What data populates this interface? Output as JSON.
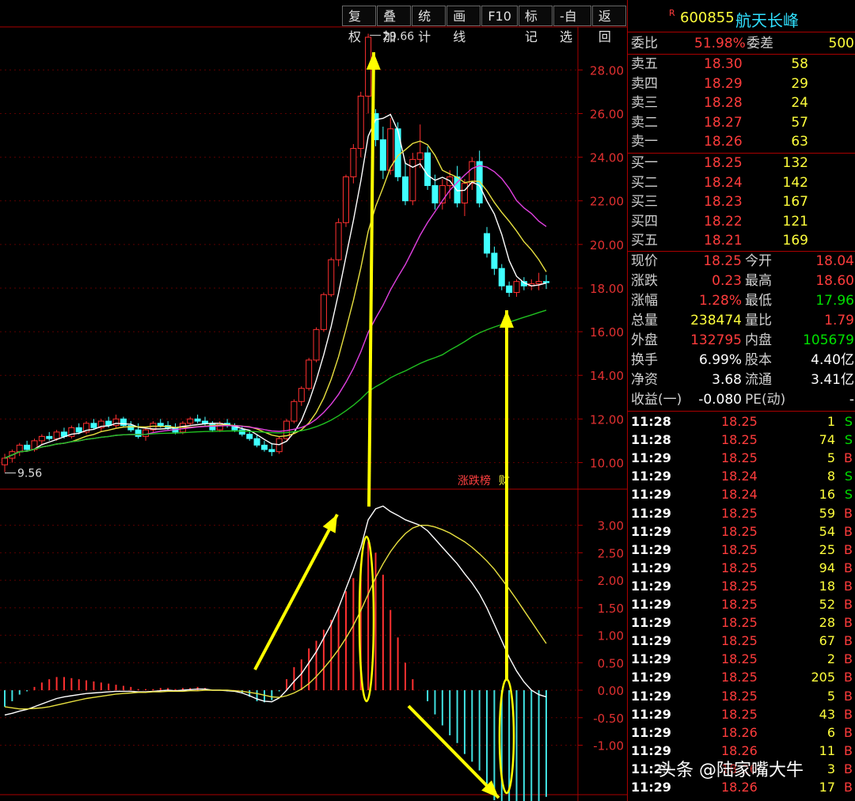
{
  "toolbar": [
    "复权",
    "叠加",
    "统计",
    "画线",
    "F10",
    "标记",
    "-自选",
    "返回"
  ],
  "stock": {
    "r_mark": "R",
    "code": "600855",
    "name": "航天长峰"
  },
  "commission": {
    "label1": "委比",
    "ratio": "51.98%",
    "label2": "委差",
    "diff": "500"
  },
  "asks": [
    {
      "label": "卖五",
      "price": "18.30",
      "vol": "58"
    },
    {
      "label": "卖四",
      "price": "18.29",
      "vol": "29"
    },
    {
      "label": "卖三",
      "price": "18.28",
      "vol": "24"
    },
    {
      "label": "卖二",
      "price": "18.27",
      "vol": "57"
    },
    {
      "label": "卖一",
      "price": "18.26",
      "vol": "63"
    }
  ],
  "bids": [
    {
      "label": "买一",
      "price": "18.25",
      "vol": "132"
    },
    {
      "label": "买二",
      "price": "18.24",
      "vol": "142"
    },
    {
      "label": "买三",
      "price": "18.23",
      "vol": "167"
    },
    {
      "label": "买四",
      "price": "18.22",
      "vol": "121"
    },
    {
      "label": "买五",
      "price": "18.21",
      "vol": "169"
    }
  ],
  "stats": [
    {
      "l1": "现价",
      "v1": "18.25",
      "c1": "red",
      "l2": "今开",
      "v2": "18.04",
      "c2": "red"
    },
    {
      "l1": "涨跌",
      "v1": "0.23",
      "c1": "red",
      "l2": "最高",
      "v2": "18.60",
      "c2": "red"
    },
    {
      "l1": "涨幅",
      "v1": "1.28%",
      "c1": "red",
      "l2": "最低",
      "v2": "17.96",
      "c2": "grn"
    },
    {
      "l1": "总量",
      "v1": "238474",
      "c1": "yel",
      "l2": "量比",
      "v2": "1.79",
      "c2": "red"
    },
    {
      "l1": "外盘",
      "v1": "132795",
      "c1": "red",
      "l2": "内盘",
      "v2": "105679",
      "c2": "grn"
    },
    {
      "l1": "换手",
      "v1": "6.99%",
      "c1": "wht",
      "l2": "股本",
      "v2": "4.40亿",
      "c2": "wht"
    },
    {
      "l1": "净资",
      "v1": "3.68",
      "c1": "wht",
      "l2": "流通",
      "v2": "3.41亿",
      "c2": "wht"
    },
    {
      "l1": "收益(一)",
      "v1": "-0.080",
      "c1": "wht",
      "l2": "PE(动)",
      "v2": "-",
      "c2": "wht"
    }
  ],
  "ticks": [
    {
      "t": "11:28",
      "p": "18.25",
      "v": "1",
      "s": "S"
    },
    {
      "t": "11:28",
      "p": "18.25",
      "v": "74",
      "s": "S"
    },
    {
      "t": "11:29",
      "p": "18.25",
      "v": "5",
      "s": "B"
    },
    {
      "t": "11:29",
      "p": "18.24",
      "v": "8",
      "s": "S"
    },
    {
      "t": "11:29",
      "p": "18.24",
      "v": "16",
      "s": "S"
    },
    {
      "t": "11:29",
      "p": "18.25",
      "v": "59",
      "s": "B"
    },
    {
      "t": "11:29",
      "p": "18.25",
      "v": "54",
      "s": "B"
    },
    {
      "t": "11:29",
      "p": "18.25",
      "v": "25",
      "s": "B"
    },
    {
      "t": "11:29",
      "p": "18.25",
      "v": "94",
      "s": "B"
    },
    {
      "t": "11:29",
      "p": "18.25",
      "v": "18",
      "s": "B"
    },
    {
      "t": "11:29",
      "p": "18.25",
      "v": "52",
      "s": "B"
    },
    {
      "t": "11:29",
      "p": "18.25",
      "v": "28",
      "s": "B"
    },
    {
      "t": "11:29",
      "p": "18.25",
      "v": "67",
      "s": "B"
    },
    {
      "t": "11:29",
      "p": "18.25",
      "v": "2",
      "s": "B"
    },
    {
      "t": "11:29",
      "p": "18.25",
      "v": "205",
      "s": "B"
    },
    {
      "t": "11:29",
      "p": "18.25",
      "v": "5",
      "s": "B"
    },
    {
      "t": "11:29",
      "p": "18.25",
      "v": "43",
      "s": "B"
    },
    {
      "t": "11:29",
      "p": "18.26",
      "v": "6",
      "s": "B"
    },
    {
      "t": "11:29",
      "p": "18.26",
      "v": "11",
      "s": "B"
    },
    {
      "t": "11:29",
      "p": "18.26",
      "v": "3",
      "s": "B"
    },
    {
      "t": "11:29",
      "p": "18.26",
      "v": "17",
      "s": "B"
    }
  ],
  "chart_labels": {
    "high": "29.66",
    "low": "9.56",
    "zhangdie": "涨跌榜",
    "cai": "财"
  },
  "watermark": "头条 @陆家嘴大牛",
  "chart_data": {
    "type": "candlestick",
    "price_axis": {
      "ticks": [
        28,
        26,
        24,
        22,
        20,
        18,
        16,
        14,
        12,
        10
      ],
      "labels": [
        "28.00",
        "26.00",
        "24.00",
        "22.00",
        "20.00",
        "18.00",
        "16.00",
        "14.00",
        "12.00",
        "10.00"
      ],
      "ylim": [
        9.0,
        29.9
      ]
    },
    "macd_axis": {
      "ticks": [
        3,
        2.5,
        2,
        1.5,
        1,
        0.5,
        0,
        -0.5,
        -1
      ],
      "labels": [
        "3.00",
        "2.50",
        "2.00",
        "1.50",
        "1.00",
        "0.50",
        "0.00",
        "-0.50",
        "-1.00"
      ],
      "ylim": [
        -1.9,
        3.6
      ]
    },
    "candles": [
      [
        9.9,
        10.4,
        9.56,
        10.2
      ],
      [
        10.2,
        10.6,
        10.0,
        10.5
      ],
      [
        10.5,
        10.9,
        10.3,
        10.8
      ],
      [
        10.8,
        11.0,
        10.5,
        10.6
      ],
      [
        10.6,
        11.1,
        10.5,
        11.0
      ],
      [
        11.0,
        11.3,
        10.8,
        11.2
      ],
      [
        11.2,
        11.4,
        11.0,
        11.1
      ],
      [
        11.1,
        11.5,
        11.0,
        11.4
      ],
      [
        11.4,
        11.6,
        11.1,
        11.2
      ],
      [
        11.2,
        11.7,
        11.1,
        11.6
      ],
      [
        11.6,
        11.8,
        11.3,
        11.4
      ],
      [
        11.4,
        11.9,
        11.3,
        11.8
      ],
      [
        11.8,
        12.0,
        11.5,
        11.6
      ],
      [
        11.6,
        12.0,
        11.4,
        11.9
      ],
      [
        11.9,
        12.1,
        11.6,
        11.7
      ],
      [
        11.7,
        12.2,
        11.6,
        12.0
      ],
      [
        12.0,
        12.1,
        11.6,
        11.7
      ],
      [
        11.7,
        11.9,
        11.4,
        11.5
      ],
      [
        11.5,
        11.8,
        11.1,
        11.2
      ],
      [
        11.2,
        11.6,
        11.0,
        11.5
      ],
      [
        11.5,
        11.9,
        11.4,
        11.8
      ],
      [
        11.8,
        12.0,
        11.6,
        11.7
      ],
      [
        11.7,
        11.9,
        11.5,
        11.6
      ],
      [
        11.6,
        11.8,
        11.3,
        11.4
      ],
      [
        11.4,
        11.9,
        11.3,
        11.8
      ],
      [
        11.8,
        12.1,
        11.7,
        12.0
      ],
      [
        12.0,
        12.2,
        11.8,
        11.9
      ],
      [
        11.9,
        12.1,
        11.7,
        11.8
      ],
      [
        11.8,
        11.9,
        11.4,
        11.5
      ],
      [
        11.5,
        11.9,
        11.4,
        11.8
      ],
      [
        11.8,
        12.0,
        11.6,
        11.7
      ],
      [
        11.7,
        11.8,
        11.4,
        11.5
      ],
      [
        11.5,
        11.7,
        11.2,
        11.3
      ],
      [
        11.3,
        11.5,
        11.0,
        11.1
      ],
      [
        11.1,
        11.3,
        10.7,
        10.8
      ],
      [
        10.8,
        11.0,
        10.5,
        10.6
      ],
      [
        10.6,
        10.9,
        10.3,
        10.5
      ],
      [
        10.5,
        11.2,
        10.4,
        11.1
      ],
      [
        11.1,
        12.0,
        11.0,
        11.9
      ],
      [
        11.9,
        12.9,
        11.8,
        12.8
      ],
      [
        12.8,
        13.5,
        12.6,
        13.4
      ],
      [
        13.4,
        14.8,
        13.3,
        14.7
      ],
      [
        14.7,
        16.2,
        14.6,
        16.1
      ],
      [
        16.1,
        17.8,
        16.0,
        17.7
      ],
      [
        17.7,
        19.4,
        17.6,
        19.3
      ],
      [
        19.3,
        21.2,
        19.0,
        21.0
      ],
      [
        21.0,
        23.2,
        20.8,
        23.1
      ],
      [
        23.1,
        24.6,
        22.8,
        24.4
      ],
      [
        24.4,
        27.0,
        24.0,
        26.8
      ],
      [
        26.8,
        29.66,
        26.0,
        29.5
      ],
      [
        26.0,
        26.2,
        24.5,
        24.8
      ],
      [
        24.8,
        25.4,
        23.0,
        23.4
      ],
      [
        23.4,
        25.8,
        23.2,
        25.3
      ],
      [
        25.3,
        25.6,
        22.9,
        23.1
      ],
      [
        23.1,
        23.8,
        21.8,
        22.0
      ],
      [
        22.0,
        24.2,
        21.8,
        23.9
      ],
      [
        23.9,
        25.5,
        23.5,
        24.2
      ],
      [
        24.2,
        24.5,
        22.5,
        22.7
      ],
      [
        22.7,
        23.2,
        21.6,
        21.9
      ],
      [
        21.9,
        23.0,
        21.6,
        22.7
      ],
      [
        22.7,
        23.4,
        22.1,
        23.1
      ],
      [
        23.1,
        23.6,
        21.7,
        21.9
      ],
      [
        21.9,
        23.0,
        21.3,
        22.8
      ],
      [
        22.8,
        24.0,
        22.5,
        23.8
      ],
      [
        23.8,
        24.3,
        21.7,
        21.9
      ],
      [
        20.5,
        20.8,
        19.4,
        19.6
      ],
      [
        19.6,
        19.9,
        18.6,
        18.9
      ],
      [
        18.9,
        19.1,
        17.9,
        18.1
      ],
      [
        18.1,
        18.3,
        17.6,
        17.8
      ],
      [
        17.8,
        18.4,
        17.6,
        18.3
      ],
      [
        18.3,
        18.5,
        17.9,
        18.1
      ],
      [
        18.1,
        18.4,
        17.9,
        18.2
      ],
      [
        18.2,
        18.7,
        17.9,
        18.3
      ],
      [
        18.3,
        18.6,
        17.96,
        18.25
      ]
    ],
    "macd_diff": [
      -0.45,
      -0.42,
      -0.38,
      -0.35,
      -0.3,
      -0.25,
      -0.2,
      -0.15,
      -0.12,
      -0.1,
      -0.08,
      -0.06,
      -0.05,
      -0.04,
      -0.03,
      -0.02,
      -0.02,
      -0.02,
      -0.03,
      -0.03,
      -0.02,
      -0.01,
      0.0,
      -0.01,
      0.0,
      0.01,
      0.02,
      0.02,
      0.0,
      0.0,
      -0.01,
      -0.02,
      -0.05,
      -0.1,
      -0.16,
      -0.2,
      -0.21,
      -0.14,
      0.0,
      0.16,
      0.3,
      0.5,
      0.7,
      0.95,
      1.2,
      1.5,
      1.85,
      2.2,
      2.6,
      3.1,
      3.3,
      3.35,
      3.25,
      3.18,
      3.1,
      3.05,
      3.0,
      2.9,
      2.75,
      2.6,
      2.45,
      2.3,
      2.12,
      1.95,
      1.75,
      1.5,
      1.2,
      0.9,
      0.6,
      0.35,
      0.15,
      0.0,
      -0.08,
      -0.12
    ],
    "macd_dea": [
      -0.3,
      -0.32,
      -0.34,
      -0.34,
      -0.33,
      -0.32,
      -0.3,
      -0.27,
      -0.24,
      -0.21,
      -0.18,
      -0.15,
      -0.13,
      -0.11,
      -0.09,
      -0.07,
      -0.06,
      -0.05,
      -0.04,
      -0.04,
      -0.03,
      -0.03,
      -0.02,
      -0.02,
      -0.02,
      -0.01,
      -0.01,
      0.0,
      0.0,
      0.0,
      0.0,
      -0.01,
      -0.02,
      -0.04,
      -0.06,
      -0.09,
      -0.12,
      -0.13,
      -0.1,
      -0.05,
      0.02,
      0.12,
      0.25,
      0.4,
      0.56,
      0.74,
      0.95,
      1.18,
      1.45,
      1.75,
      2.05,
      2.3,
      2.52,
      2.7,
      2.85,
      2.95,
      3.0,
      3.0,
      2.97,
      2.92,
      2.86,
      2.78,
      2.7,
      2.6,
      2.48,
      2.35,
      2.2,
      2.02,
      1.84,
      1.65,
      1.45,
      1.25,
      1.05,
      0.85
    ]
  }
}
